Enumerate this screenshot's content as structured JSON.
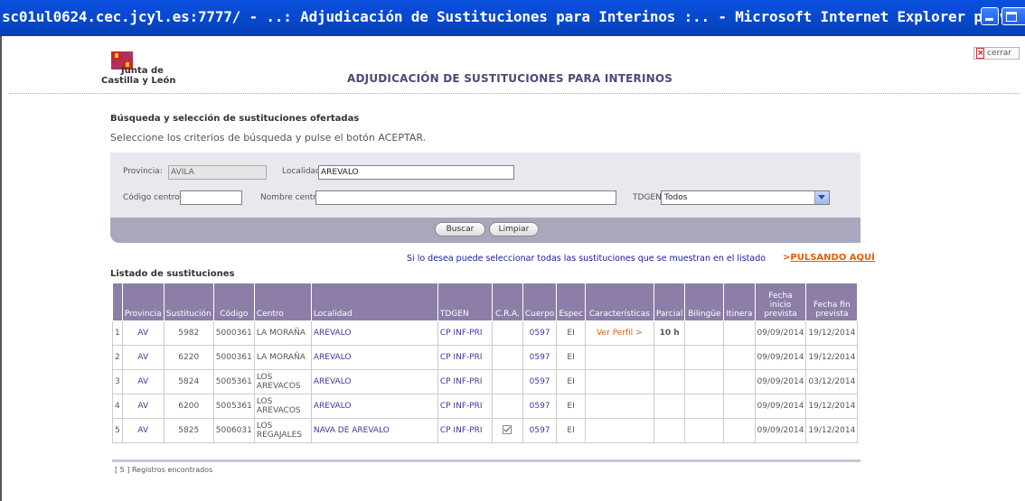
{
  "window": {
    "title": "sc01ul0624.cec.jcyl.es:7777/ - ..: Adjudicación de Sustituciones para Interinos :.. - Microsoft Internet Explorer provid"
  },
  "header": {
    "close_label": "cerrar",
    "close_icon": "close-icon",
    "logo_line1": "Junta de",
    "logo_line2": "Castilla y León",
    "app_title": "ADJUDICACIÓN DE SUSTITUCIONES PARA INTERINOS"
  },
  "search": {
    "section_title": "Búsqueda y selección de sustituciones ofertadas",
    "instructions": "Seleccione los criterios de búsqueda y pulse el botón ACEPTAR.",
    "provincia_label": "Provincia:",
    "provincia_value": "AVILA",
    "localidad_label": "Localidad",
    "localidad_value": "AREVALO",
    "codigo_label": "Código centro",
    "codigo_value": "",
    "nombre_label": "Nombre centro",
    "nombre_value": "",
    "tdgen_label": "TDGEN",
    "tdgen_value": "Todos",
    "buscar_label": "Buscar",
    "limpiar_label": "Limpiar"
  },
  "select_all": {
    "text": "Si lo desea puede seleccionar todas las sustituciones que se muestran en el listado",
    "arrow": ">",
    "link": "PULSANDO AQUÍ"
  },
  "list": {
    "title": "Listado de sustituciones",
    "columns": [
      "",
      "Provincia",
      "Sustitución",
      "Código",
      "Centro",
      "Localidad",
      "TDGEN",
      "C.R.A.",
      "Cuerpo",
      "Espec",
      "Características",
      "Parcial",
      "Bilingüe",
      "Itinera",
      "Fecha inicio prevista",
      "Fecha fin prevista"
    ],
    "col_fecha_inicio_1": "Fecha",
    "col_fecha_inicio_2": "inicio",
    "col_fecha_inicio_3": "prevista",
    "col_fecha_fin_1": "Fecha fin",
    "col_fecha_fin_2": "prevista",
    "rows": [
      {
        "n": "1",
        "provincia": "AV",
        "sustitucion": "5982",
        "codigo": "5000361",
        "centro": "LA MORAÑA",
        "localidad": "AREVALO",
        "tdgen": "CP INF-PRI",
        "cra": "",
        "cuerpo": "0597",
        "espec": "EI",
        "caracteristicas": "Ver Perfil",
        "caracteristicas_arrow": ">",
        "parcial": "10 h",
        "bilingue": "",
        "itinera": "",
        "inicio": "09/09/2014",
        "fin": "19/12/2014"
      },
      {
        "n": "2",
        "provincia": "AV",
        "sustitucion": "6220",
        "codigo": "5000361",
        "centro": "LA MORAÑA",
        "localidad": "AREVALO",
        "tdgen": "CP INF-PRI",
        "cra": "",
        "cuerpo": "0597",
        "espec": "EI",
        "caracteristicas": "",
        "parcial": "",
        "bilingue": "",
        "itinera": "",
        "inicio": "09/09/2014",
        "fin": "19/12/2014"
      },
      {
        "n": "3",
        "provincia": "AV",
        "sustitucion": "5824",
        "codigo": "5005361",
        "centro": "LOS AREVACOS",
        "localidad": "AREVALO",
        "tdgen": "CP INF-PRI",
        "cra": "",
        "cuerpo": "0597",
        "espec": "EI",
        "caracteristicas": "",
        "parcial": "",
        "bilingue": "",
        "itinera": "",
        "inicio": "09/09/2014",
        "fin": "03/12/2014"
      },
      {
        "n": "4",
        "provincia": "AV",
        "sustitucion": "6200",
        "codigo": "5005361",
        "centro": "LOS AREVACOS",
        "localidad": "AREVALO",
        "tdgen": "CP INF-PRI",
        "cra": "",
        "cuerpo": "0597",
        "espec": "EI",
        "caracteristicas": "",
        "parcial": "",
        "bilingue": "",
        "itinera": "",
        "inicio": "09/09/2014",
        "fin": "19/12/2014"
      },
      {
        "n": "5",
        "provincia": "AV",
        "sustitucion": "5825",
        "codigo": "5006031",
        "centro": "LOS REGAJALES",
        "localidad": "NAVA DE AREVALO",
        "tdgen": "CP INF-PRI",
        "cra": "checked",
        "cuerpo": "0597",
        "espec": "EI",
        "caracteristicas": "",
        "parcial": "",
        "bilingue": "",
        "itinera": "",
        "inicio": "09/09/2014",
        "fin": "19/12/2014"
      }
    ],
    "count_text": "[ 5 ] Registros encontrados"
  },
  "colors": {
    "titlebar": "#0747c8",
    "table_header": "#8c7ea6",
    "filter_bg": "#e9e8ef",
    "button_bar": "#aaa7bd",
    "accent_orange": "#e06000"
  }
}
